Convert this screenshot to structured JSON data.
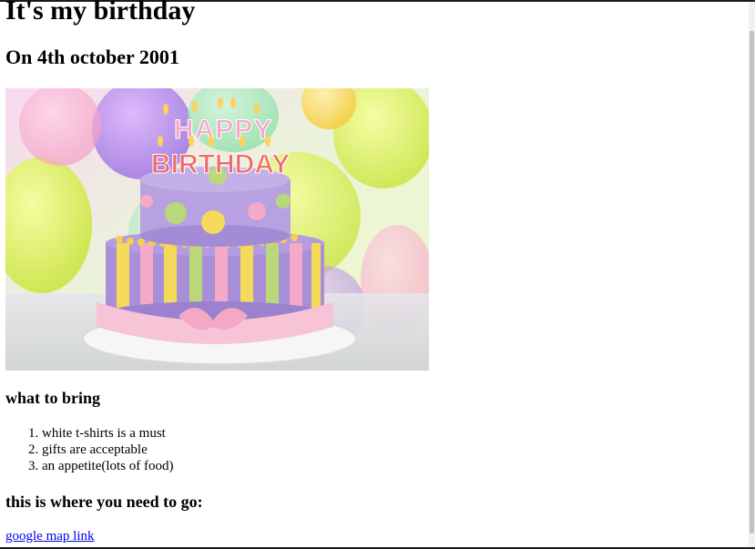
{
  "page": {
    "title": "It's my birthday",
    "subtitle": "On 4th october 2001"
  },
  "image": {
    "icon": "birthday-cake-photo",
    "cake_text_line1": "HAPPY",
    "cake_text_line2": "BIRTHDAY",
    "colors": {
      "cake_top": "#b8a1e0",
      "cake_bottom": "#a98fd8",
      "stripe_yellow": "#f5d95a",
      "stripe_pink": "#f4a9c8",
      "stripe_green": "#b8d879",
      "ribbon": "#f7c3d6",
      "board": "#f4f4f4"
    }
  },
  "bring": {
    "heading": "what to bring",
    "items": [
      "white t-shirts is a must",
      "gifts are acceptable",
      "an appetite(lots of food)"
    ]
  },
  "directions": {
    "heading": "this is where you need to go:",
    "link_text": "google map link"
  }
}
